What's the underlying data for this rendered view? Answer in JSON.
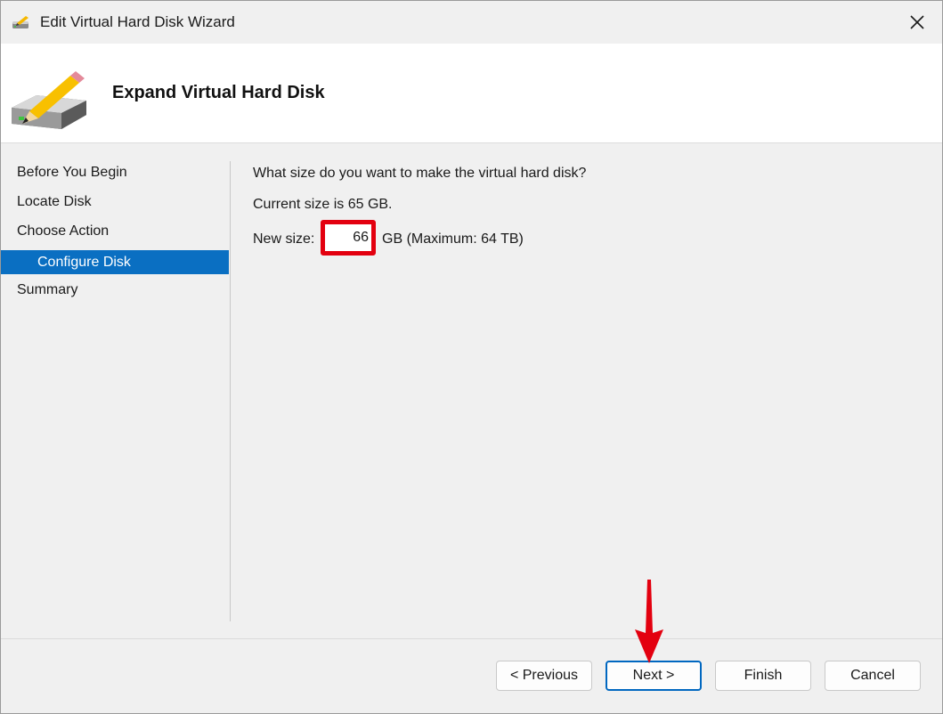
{
  "window": {
    "title": "Edit Virtual Hard Disk Wizard"
  },
  "header": {
    "title": "Expand Virtual Hard Disk"
  },
  "nav": {
    "items": [
      {
        "label": "Before You Begin"
      },
      {
        "label": "Locate Disk"
      },
      {
        "label": "Choose Action"
      },
      {
        "label": "Configure Disk"
      },
      {
        "label": "Summary"
      }
    ]
  },
  "content": {
    "question": "What size do you want to make the virtual hard disk?",
    "current_size": "Current size is 65 GB.",
    "new_size_label": "New size:",
    "new_size_value": "66",
    "unit_text": "GB (Maximum: 64 TB)"
  },
  "buttons": {
    "previous": "< Previous",
    "next": "Next >",
    "finish": "Finish",
    "cancel": "Cancel"
  },
  "colors": {
    "accent": "#0a6fc2",
    "highlight": "#e3000f"
  },
  "icons": {
    "title": "disk-edit-icon",
    "close": "close-icon",
    "header": "hard-disk-pencil-icon",
    "annotation": "red-down-arrow-icon"
  }
}
